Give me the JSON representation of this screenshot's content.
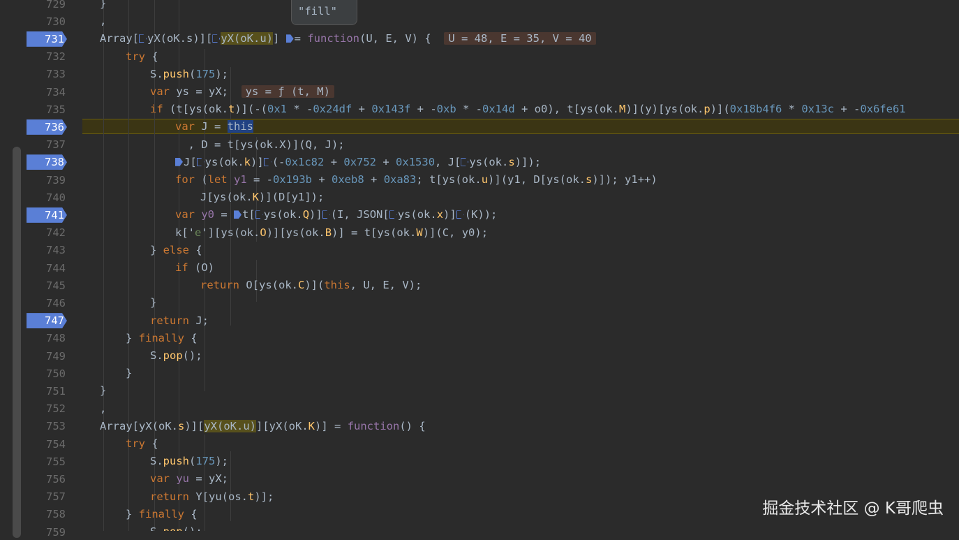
{
  "tooltip": {
    "text": "\"fill\""
  },
  "watermark": "掘金技术社区 @ K哥爬虫",
  "lines": [
    {
      "n": "729",
      "bp": false
    },
    {
      "n": "730",
      "bp": false
    },
    {
      "n": "731",
      "bp": true
    },
    {
      "n": "732",
      "bp": false
    },
    {
      "n": "733",
      "bp": false
    },
    {
      "n": "734",
      "bp": false
    },
    {
      "n": "735",
      "bp": false
    },
    {
      "n": "736",
      "bp": true
    },
    {
      "n": "737",
      "bp": false
    },
    {
      "n": "738",
      "bp": true
    },
    {
      "n": "739",
      "bp": false
    },
    {
      "n": "740",
      "bp": false
    },
    {
      "n": "741",
      "bp": true
    },
    {
      "n": "742",
      "bp": false
    },
    {
      "n": "743",
      "bp": false
    },
    {
      "n": "744",
      "bp": false
    },
    {
      "n": "745",
      "bp": false
    },
    {
      "n": "746",
      "bp": false
    },
    {
      "n": "747",
      "bp": true
    },
    {
      "n": "748",
      "bp": false
    },
    {
      "n": "749",
      "bp": false
    },
    {
      "n": "750",
      "bp": false
    },
    {
      "n": "751",
      "bp": false
    },
    {
      "n": "752",
      "bp": false
    },
    {
      "n": "753",
      "bp": false
    },
    {
      "n": "754",
      "bp": false
    },
    {
      "n": "755",
      "bp": false
    },
    {
      "n": "756",
      "bp": false
    },
    {
      "n": "757",
      "bp": false
    },
    {
      "n": "758",
      "bp": false
    },
    {
      "n": "759",
      "bp": false
    }
  ],
  "code": {
    "l729": "}",
    "l730": ",",
    "l731": [
      "Array[",
      "yX(oK.s)",
      "][",
      "yX(oK.u)",
      "] ",
      "=",
      " ",
      "function",
      "(U, E, V) {  ",
      "U = 48, E = 35, V = 40"
    ],
    "l732": [
      "try",
      " {"
    ],
    "l733": [
      "S.",
      "push",
      "(",
      "175",
      ");"
    ],
    "l734": [
      "var",
      " ys = yX;  ",
      "ys = ƒ (t, M)"
    ],
    "l735": [
      "if",
      " (t[ys(ok.",
      "t",
      ")](-(",
      "0x1",
      " * -",
      "0x24df",
      " + ",
      "0x143f",
      " + -",
      "0xb",
      " * -",
      "0x14d",
      " + o0), t[ys(ok.",
      "M",
      ")](y)[ys(ok.",
      "p",
      ")](",
      "0x18b4f6",
      " * ",
      "0x13c",
      " + -",
      "0x6fe61"
    ],
    "l736": [
      "var",
      " J = ",
      "this"
    ],
    "l737": "  , D = t[ys(ok.X)](Q, J);",
    "l738": [
      "J[",
      "ys(ok.",
      "k",
      ")]",
      "(-",
      "0x1c82",
      " + ",
      "0x752",
      " + ",
      "0x1530",
      ", J[",
      "ys(ok.",
      "s",
      ")]);"
    ],
    "l739": [
      "for",
      " (",
      "let",
      " ",
      "y1",
      " = -",
      "0x193b",
      " + ",
      "0xeb8",
      " + ",
      "0xa83",
      "; t[ys(ok.",
      "u",
      ")](y1, D[ys(ok.",
      "s",
      ")]); y1++)"
    ],
    "l740": [
      "J[ys(ok.",
      "K",
      ")](D[y1]);"
    ],
    "l741": [
      "var",
      " ",
      "y0",
      " = ",
      "t[",
      "ys(ok.",
      "Q",
      ")]",
      "(I, JSON[",
      "ys(ok.",
      "x",
      ")]",
      "(K));"
    ],
    "l742": [
      "k['",
      "e",
      "'][ys(ok.",
      "O",
      ")][ys(ok.",
      "B",
      ")] = t[ys(ok.",
      "W",
      ")](C, y0);"
    ],
    "l743": [
      "} ",
      "else",
      " {"
    ],
    "l744": [
      "if",
      " (O)"
    ],
    "l745": [
      "return",
      " O[ys(ok.",
      "C",
      ")](",
      "this",
      ", U, E, V);"
    ],
    "l746": "}",
    "l747": [
      "return",
      " J;"
    ],
    "l748": [
      "} ",
      "finally",
      " {"
    ],
    "l749": [
      "S.",
      "pop",
      "();"
    ],
    "l750": "}",
    "l751": "}",
    "l752": ",",
    "l753": [
      "Array[yX(oK.",
      "s",
      ")][",
      "yX(oK.",
      "u",
      ")",
      "][yX(oK.",
      "K",
      ")] = ",
      "function",
      "() {"
    ],
    "l754": [
      "try",
      " {"
    ],
    "l755": [
      "S.",
      "push",
      "(",
      "175",
      ");"
    ],
    "l756": [
      "var",
      " ",
      "yu",
      " = yX;"
    ],
    "l757": [
      "return",
      " Y[yu(os.",
      "t",
      ")];"
    ],
    "l758": [
      "} ",
      "finally",
      " {"
    ],
    "l759": [
      "S.",
      "pop",
      "();"
    ]
  }
}
